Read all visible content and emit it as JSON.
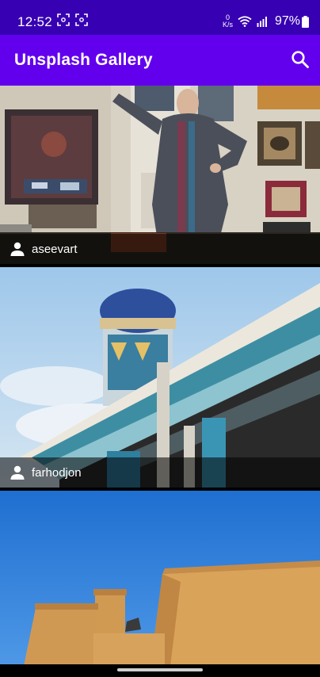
{
  "status": {
    "time": "12:52",
    "net_speed_top": "0",
    "net_speed_unit": "K/s",
    "battery": "97%"
  },
  "appbar": {
    "title": "Unsplash Gallery",
    "search_icon": "search-icon"
  },
  "photos": [
    {
      "author": "aseevart",
      "subject": "shopkeeper in carpet shop"
    },
    {
      "author": "farhodjon",
      "subject": "tiled dome and carved portico"
    },
    {
      "author": "",
      "subject": "desert fortress wall under blue sky"
    }
  ],
  "colors": {
    "statusbar": "#3700b3",
    "appbar": "#6200ee"
  }
}
